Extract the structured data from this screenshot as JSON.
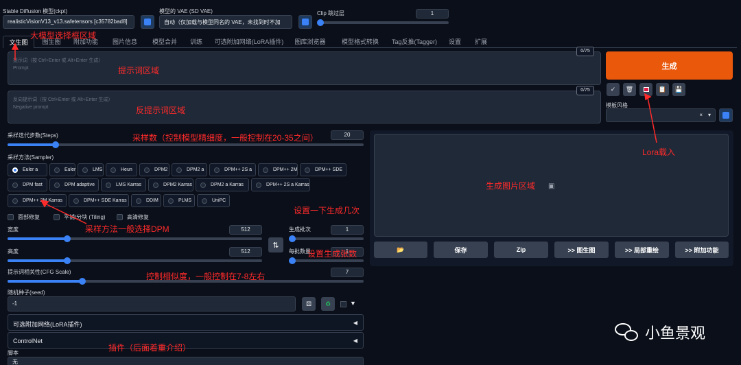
{
  "top": {
    "ckpt_label": "Stable Diffusion 模型(ckpt)",
    "ckpt_value": "realisticVisionV13_v13.safetensors [c35782bad8]",
    "vae_label": "模型的 VAE (SD VAE)",
    "vae_value": "自动（仅加载与模型同名的 VAE，未找到时不加",
    "clip_label": "Clip 跳过层",
    "clip_value": "1",
    "clip_fraction": 0.0
  },
  "tabs": [
    "文生图",
    "图生图",
    "附加功能",
    "图片信息",
    "模型合并",
    "训练",
    "可选附加网络(LoRA插件)",
    "图库浏览器",
    "模型格式转换",
    "Tag反推(Tagger)",
    "设置",
    "扩展"
  ],
  "prompt": {
    "counter": "0/75",
    "placeholder_cn": "提示词（按 Ctrl+Enter 或 Alt+Enter 生成）",
    "placeholder_en": "Prompt"
  },
  "neg": {
    "counter": "0/75",
    "placeholder_cn": "反向提示词（按 Ctrl+Enter 或 Alt+Enter 生成）",
    "placeholder_en": "Negative prompt"
  },
  "generate_label": "生成",
  "tool_icons": [
    "check-icon",
    "trash-icon",
    "lora-icon",
    "clipboard-icon",
    "save-icon"
  ],
  "style": {
    "label": "模板风格",
    "clear": "×",
    "arrow": "▾"
  },
  "steps": {
    "label": "采样迭代步数(Steps)",
    "value": "20",
    "fraction": 0.135
  },
  "sampler": {
    "label": "采样方法(Sampler)",
    "options": [
      "Euler a",
      "Euler",
      "LMS",
      "Heun",
      "DPM2",
      "DPM2 a",
      "DPM++ 2S a",
      "DPM++ 2M",
      "DPM++ SDE",
      "DPM fast",
      "DPM adaptive",
      "LMS Karras",
      "DPM2 Karras",
      "DPM2 a Karras",
      "DPM++ 2S a Karras",
      "DPM++ 2M Karras",
      "DPM++ SDE Karras",
      "DDIM",
      "PLMS",
      "UniPC"
    ],
    "selected": "Euler a"
  },
  "checks": [
    "面部修复",
    "平铺/分块 (Tiling)",
    "高清修复"
  ],
  "width": {
    "label": "宽度",
    "value": "512",
    "fraction": 0.23
  },
  "height": {
    "label": "高度",
    "value": "512",
    "fraction": 0.23
  },
  "swap_icon": "⇅",
  "batch_count": {
    "label": "生成批次",
    "value": "1",
    "fraction": 0.0
  },
  "batch_size": {
    "label": "每批数量",
    "value": "1",
    "fraction": 0.0
  },
  "cfg": {
    "label": "提示词相关性(CFG Scale)",
    "value": "7",
    "fraction": 0.21
  },
  "seed": {
    "label": "随机种子(seed)",
    "value": "-1"
  },
  "output_buttons": [
    "📂",
    "保存",
    "Zip",
    ">> 图生图",
    ">> 局部重绘",
    ">> 附加功能"
  ],
  "accordions": [
    {
      "label": "可选附加网络(LoRA插件)",
      "arrow": "◀"
    },
    {
      "label": "ControlNet",
      "arrow": "◀"
    }
  ],
  "script": {
    "label": "脚本",
    "value": "无"
  },
  "annotations": [
    "大模型选择框区域",
    "提示词区域",
    "反提示词区域",
    "采样数（控制模型精细度，一般控制在20-35之间）",
    "采样方法一般选择DPM",
    "设置一下生成几次",
    "设置生成张数",
    "控制相似度，一般控制在7-8左右",
    "插件（后面着重介绍）",
    "生成图片区域",
    "Lora载入"
  ],
  "watermark": "小鱼景观",
  "colors": {
    "generate": "#ea580c",
    "accent": "#3b82f6",
    "annotation": "#ff2b2b",
    "bg": "#0b0f19"
  }
}
